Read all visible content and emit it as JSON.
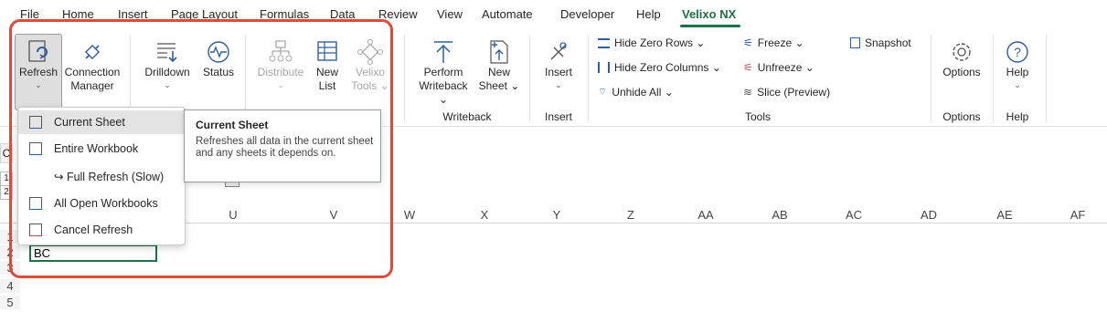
{
  "menu": {
    "items": [
      "File",
      "Home",
      "Insert",
      "Page Layout",
      "Formulas",
      "Data",
      "Review",
      "View",
      "Automate",
      "Developer",
      "Help",
      "Velixo NX"
    ],
    "active": "Velixo NX"
  },
  "ribbon": {
    "refresh": {
      "label": "Refresh",
      "caret": "⌄"
    },
    "connection_manager": {
      "line1": "Connection",
      "line2": "Manager"
    },
    "drilldown": {
      "label": "Drilldown",
      "caret": "⌄"
    },
    "status": {
      "label": "Status"
    },
    "distribute": {
      "label": "Distribute",
      "caret": "⌄"
    },
    "new_list": {
      "line1": "New",
      "line2": "List"
    },
    "velixo_tools": {
      "line1": "Velixo",
      "line2": "Tools ⌄"
    },
    "perform_writeback": {
      "line1": "Perform",
      "line2": "Writeback ⌄"
    },
    "new_sheet": {
      "line1": "New",
      "line2": "Sheet ⌄"
    },
    "insert": {
      "line1": "Insert",
      "caret": "⌄"
    },
    "hide_zero_rows": "Hide Zero Rows ⌄",
    "hide_zero_columns": "Hide Zero Columns ⌄",
    "unhide_all": "Unhide All ⌄",
    "freeze": "Freeze ⌄",
    "unfreeze": "Unfreeze ⌄",
    "slice": "Slice (Preview)",
    "snapshot": "Snapshot",
    "options": {
      "label": "Options"
    },
    "help": {
      "label": "Help",
      "caret": "⌄"
    },
    "groups": {
      "writeback": "Writeback",
      "insert": "Insert",
      "tools": "Tools",
      "options": "Options",
      "help": "Help"
    }
  },
  "dropdown": {
    "items": [
      {
        "label": "Current Sheet"
      },
      {
        "label": "Entire Workbook"
      },
      {
        "label": "↪ Full Refresh (Slow)"
      },
      {
        "label": "All Open Workbooks"
      },
      {
        "label": "Cancel Refresh"
      }
    ]
  },
  "tooltip": {
    "title": "Current Sheet",
    "body": "Refreshes all data in the current sheet and any sheets it depends on."
  },
  "sheet": {
    "name_box_fragment": "C",
    "columns": [
      "U",
      "V",
      "W",
      "X",
      "Y",
      "Z",
      "AA",
      "AB",
      "AC",
      "AD",
      "AE",
      "AF"
    ],
    "rows": [
      "1",
      "2",
      "3",
      "4",
      "5"
    ],
    "outline_levels": [
      "1",
      "2"
    ],
    "active_cell_value": "BC"
  },
  "colors": {
    "accent": "#1e7145",
    "highlight_frame": "#dd4b39",
    "icon_blue": "#2f5e9e"
  }
}
